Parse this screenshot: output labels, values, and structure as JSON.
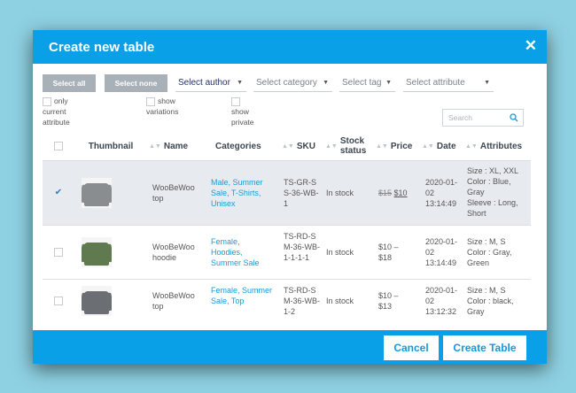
{
  "modal": {
    "title": "Create new table"
  },
  "toolbar": {
    "select_all": "Select all",
    "select_none": "Select none",
    "author": "Select author",
    "category": "Select category",
    "tag": "Select tag",
    "attribute": "Select attribute"
  },
  "options": {
    "only_current_attribute": "only current attribute",
    "show_variations": "show variations",
    "show_private": "show private"
  },
  "search": {
    "placeholder": "Search"
  },
  "table": {
    "columns": [
      "Thumbnail",
      "Name",
      "Categories",
      "SKU",
      "Stock status",
      "Price",
      "Date",
      "Attributes"
    ],
    "rows": [
      {
        "selected": true,
        "name": "WooBeWoo top",
        "categories": "Male, Summer Sale, T-Shirts, Unisex",
        "sku": "TS-GR-SS-36-WB-1",
        "stock": "In stock",
        "price_old": "$15",
        "price_new": "$10",
        "date": "2020-01-02 13:14:49",
        "attributes": "Size : XL, XXL\nColor : Blue, Gray\nSleeve : Long, Short"
      },
      {
        "selected": false,
        "name": "WooBeWoo hoodie",
        "categories": "Female, Hoodies, Summer Sale",
        "sku": "TS-RD-SM-36-WB-1-1-1-1",
        "stock": "In stock",
        "price": "$10 – $18",
        "date": "2020-01-02 13:14:49",
        "attributes": "Size : M, S\nColor : Gray, Green"
      },
      {
        "selected": false,
        "name": "WooBeWoo top",
        "categories": "Female, Summer Sale, Top",
        "sku": "TS-RD-SM-36-WB-1-2",
        "stock": "In stock",
        "price": "$10 – $13",
        "date": "2020-01-02 13:12:32",
        "attributes": "Size : M, S\nColor : black, Gray"
      }
    ]
  },
  "footer": {
    "cancel": "Cancel",
    "create": "Create Table"
  },
  "colors": {
    "accent": "#0aa0e8",
    "background": "#8ed1e2",
    "link": "#1a9ad6"
  },
  "icons": {
    "close": "close-icon",
    "search": "search-icon",
    "sort": "sort-icon",
    "check": "check-icon"
  }
}
